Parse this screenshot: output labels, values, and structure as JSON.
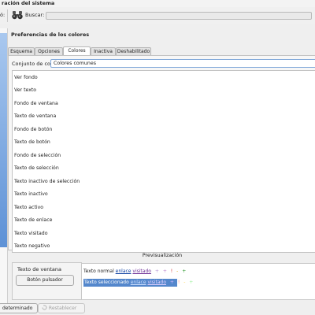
{
  "window": {
    "title": "ración del sistema"
  },
  "toolbar": {
    "back_fragment": "ó:",
    "search_label": "Buscar:",
    "search_value": "",
    "search_placeholder": ""
  },
  "page": {
    "heading": "Preferencias de los colores"
  },
  "tabs": [
    {
      "label": "Esquema",
      "active": false
    },
    {
      "label": "Opciones",
      "active": false
    },
    {
      "label": "Colores",
      "active": true
    },
    {
      "label": "Inactiva",
      "active": false
    },
    {
      "label": "Deshabilitado",
      "active": false
    }
  ],
  "colors_panel": {
    "scheme_label": "Conjunto de color:",
    "scheme_value": "Colores comunes",
    "items": [
      "Ver fondo",
      "Ver texto",
      "Fondo de ventana",
      "Texto de ventana",
      "Fondo de botón",
      "Texto de botón",
      "Fondo de selección",
      "Texto de selección",
      "Texto inactivo de selección",
      "Texto inactivo",
      "Texto activo",
      "Texto de enlace",
      "Texto visitado",
      "Texto negativo"
    ]
  },
  "preview": {
    "title": "Previsualización",
    "window_text": "Texto de ventana",
    "button_label": "Botón pulsador",
    "normal_text": "Texto normal",
    "link_text": "enlace",
    "visited_text": "visitado",
    "selected_text": "Texto seleccionado",
    "markers": [
      "+",
      "+",
      "!",
      "-",
      "+"
    ]
  },
  "bottom_bar": {
    "defaults_label": "determinado",
    "reset_label": "Restablecer"
  },
  "colors": {
    "selection": "#5487cc",
    "link": "#0a3ea0",
    "visited": "#6a2b94"
  }
}
